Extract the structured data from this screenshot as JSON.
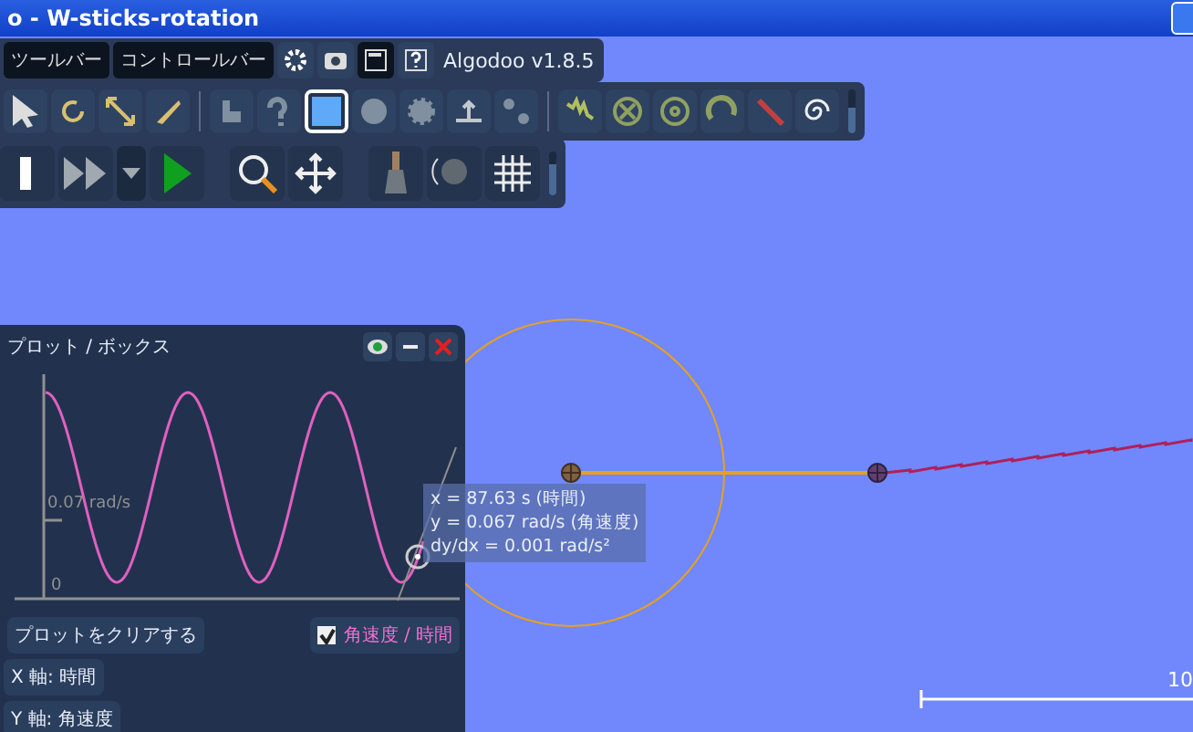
{
  "window": {
    "title": "o - W-sticks-rotation"
  },
  "top_bar": {
    "buttons": [
      "ツールバー",
      "コントロールバー"
    ],
    "app_name": "Algodoo v1.8.5"
  },
  "tools": [
    {
      "kind": "drag",
      "selected": false
    },
    {
      "kind": "rotate",
      "selected": false
    },
    {
      "kind": "scale",
      "selected": false
    },
    {
      "kind": "knife",
      "selected": false
    },
    {
      "kind": "sketch",
      "selected": false
    },
    {
      "kind": "rope",
      "selected": false
    },
    {
      "kind": "box",
      "selected": true
    },
    {
      "kind": "circle",
      "selected": false
    },
    {
      "kind": "gear",
      "selected": false
    },
    {
      "kind": "plane",
      "selected": false
    },
    {
      "kind": "chain",
      "selected": false
    },
    {
      "kind": "spring",
      "selected": false
    },
    {
      "kind": "fixate",
      "selected": false
    },
    {
      "kind": "wheel",
      "selected": false
    },
    {
      "kind": "tracer",
      "selected": false
    },
    {
      "kind": "brush",
      "selected": false
    },
    {
      "kind": "spiral",
      "selected": false
    }
  ],
  "plot_panel": {
    "title": "プロット / ボックス",
    "y_tick_label": "0.07 rad/s",
    "zero_label": "0",
    "readout": [
      "x = 87.63 s (時間)",
      "y = 0.067 rad/s (角速度)",
      "dy/dx = 0.001 rad/s²"
    ],
    "clear_button": "プロットをクリアする",
    "legend": {
      "label": "角速度 / 時間",
      "checked": true
    },
    "x_axis_button": "X 軸: 時間",
    "y_axis_button": "Y 軸: 角速度"
  },
  "tool_slider": {
    "level": 0.6
  },
  "control_slider": {
    "level": 0.7
  },
  "scale_label": "10"
}
